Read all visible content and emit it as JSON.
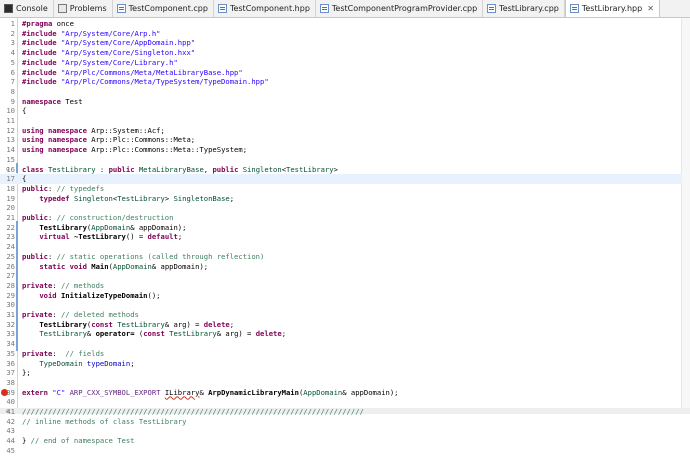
{
  "tabs": [
    {
      "label": "Console",
      "icon": "console-icon"
    },
    {
      "label": "Problems",
      "icon": "problems-icon"
    },
    {
      "label": "TestComponent.cpp",
      "icon": "cpp-file-icon"
    },
    {
      "label": "TestComponent.hpp",
      "icon": "hpp-file-icon"
    },
    {
      "label": "TestComponentProgramProvider.cpp",
      "icon": "cpp-file-icon"
    },
    {
      "label": "TestLibrary.cpp",
      "icon": "cpp-file-icon"
    },
    {
      "label": "TestLibrary.hpp",
      "icon": "hpp-file-icon",
      "active": true,
      "close": "✕"
    }
  ],
  "lines": [
    {
      "n": "1",
      "t": [
        [
          "#pragma",
          "ok"
        ],
        [
          " once",
          ""
        ]
      ]
    },
    {
      "n": "2",
      "t": [
        [
          "#include",
          "ok"
        ],
        [
          " ",
          ""
        ],
        [
          "\"Arp/System/Core/Arp.h\"",
          "st"
        ]
      ]
    },
    {
      "n": "3",
      "t": [
        [
          "#include",
          "ok"
        ],
        [
          " ",
          ""
        ],
        [
          "\"Arp/System/Core/AppDomain.hpp\"",
          "st"
        ]
      ]
    },
    {
      "n": "4",
      "t": [
        [
          "#include",
          "ok"
        ],
        [
          " ",
          ""
        ],
        [
          "\"Arp/System/Core/Singleton.hxx\"",
          "st"
        ]
      ]
    },
    {
      "n": "5",
      "t": [
        [
          "#include",
          "ok"
        ],
        [
          " ",
          ""
        ],
        [
          "\"Arp/System/Core/Library.h\"",
          "st"
        ]
      ]
    },
    {
      "n": "6",
      "t": [
        [
          "#include",
          "ok"
        ],
        [
          " ",
          ""
        ],
        [
          "\"Arp/Plc/Commons/Meta/MetaLibraryBase.hpp\"",
          "st"
        ]
      ]
    },
    {
      "n": "7",
      "t": [
        [
          "#include",
          "ok"
        ],
        [
          " ",
          ""
        ],
        [
          "\"Arp/Plc/Commons/Meta/TypeSystem/TypeDomain.hpp\"",
          "st"
        ]
      ]
    },
    {
      "n": "8",
      "t": []
    },
    {
      "n": "9",
      "t": [
        [
          "namespace",
          "ok"
        ],
        [
          " Test",
          ""
        ]
      ]
    },
    {
      "n": "10",
      "t": [
        [
          "{",
          ""
        ]
      ]
    },
    {
      "n": "11",
      "t": []
    },
    {
      "n": "12",
      "t": [
        [
          "using",
          "ok"
        ],
        [
          " ",
          ""
        ],
        [
          "namespace",
          "ok"
        ],
        [
          " Arp::System::Acf;",
          ""
        ]
      ]
    },
    {
      "n": "13",
      "t": [
        [
          "using",
          "ok"
        ],
        [
          " ",
          ""
        ],
        [
          "namespace",
          "ok"
        ],
        [
          " Arp::Plc::Commons::Meta;",
          ""
        ]
      ]
    },
    {
      "n": "14",
      "t": [
        [
          "using",
          "ok"
        ],
        [
          " ",
          ""
        ],
        [
          "namespace",
          "ok"
        ],
        [
          " Arp::Plc::Commons::Meta::TypeSystem;",
          ""
        ]
      ]
    },
    {
      "n": "15",
      "t": []
    },
    {
      "n": "16",
      "fold": "⊖",
      "t": [
        [
          "class",
          "ok"
        ],
        [
          " ",
          ""
        ],
        [
          "TestLibrary",
          "ty"
        ],
        [
          " : ",
          ""
        ],
        [
          "public",
          "ok"
        ],
        [
          " ",
          ""
        ],
        [
          "MetaLibraryBase",
          "ty"
        ],
        [
          ", ",
          ""
        ],
        [
          "public",
          "ok"
        ],
        [
          " ",
          ""
        ],
        [
          "Singleton",
          "ty"
        ],
        [
          "<",
          ""
        ],
        [
          "TestLibrary",
          "ty"
        ],
        [
          ">",
          ""
        ]
      ]
    },
    {
      "n": "17",
      "current": true,
      "t": [
        [
          "{",
          ""
        ]
      ]
    },
    {
      "n": "18",
      "t": [
        [
          "public",
          "ok"
        ],
        [
          ": ",
          ""
        ],
        [
          "// typedefs",
          "cm"
        ]
      ]
    },
    {
      "n": "19",
      "t": [
        [
          "    ",
          ""
        ],
        [
          "typedef",
          "ok"
        ],
        [
          " ",
          ""
        ],
        [
          "Singleton",
          "ty"
        ],
        [
          "<",
          ""
        ],
        [
          "TestLibrary",
          "ty"
        ],
        [
          "> ",
          ""
        ],
        [
          "SingletonBase",
          "ty"
        ],
        [
          ";",
          ""
        ]
      ]
    },
    {
      "n": "20",
      "t": []
    },
    {
      "n": "21",
      "t": [
        [
          "public",
          "ok"
        ],
        [
          ": ",
          ""
        ],
        [
          "// construction/destruction",
          "cm"
        ]
      ]
    },
    {
      "n": "22",
      "t": [
        [
          "    ",
          ""
        ],
        [
          "TestLibrary",
          "fn"
        ],
        [
          "(",
          ""
        ],
        [
          "AppDomain",
          "ty"
        ],
        [
          "& appDomain);",
          ""
        ]
      ]
    },
    {
      "n": "23",
      "t": [
        [
          "    ",
          ""
        ],
        [
          "virtual",
          "ok"
        ],
        [
          " ",
          ""
        ],
        [
          "~TestLibrary",
          "fn"
        ],
        [
          "() = ",
          ""
        ],
        [
          "default",
          "ok"
        ],
        [
          ";",
          ""
        ]
      ]
    },
    {
      "n": "24",
      "t": []
    },
    {
      "n": "25",
      "t": [
        [
          "public",
          "ok"
        ],
        [
          ": ",
          ""
        ],
        [
          "// static operations (called through reflection)",
          "cm"
        ]
      ]
    },
    {
      "n": "26",
      "t": [
        [
          "    ",
          ""
        ],
        [
          "static",
          "ok"
        ],
        [
          " ",
          ""
        ],
        [
          "void",
          "ok"
        ],
        [
          " ",
          ""
        ],
        [
          "Main",
          "fn"
        ],
        [
          "(",
          ""
        ],
        [
          "AppDomain",
          "ty"
        ],
        [
          "& appDomain);",
          ""
        ]
      ]
    },
    {
      "n": "27",
      "t": []
    },
    {
      "n": "28",
      "t": [
        [
          "private",
          "ok"
        ],
        [
          ": ",
          ""
        ],
        [
          "// methods",
          "cm"
        ]
      ]
    },
    {
      "n": "29",
      "t": [
        [
          "    ",
          ""
        ],
        [
          "void",
          "ok"
        ],
        [
          " ",
          ""
        ],
        [
          "InitializeTypeDomain",
          "fn"
        ],
        [
          "();",
          ""
        ]
      ]
    },
    {
      "n": "30",
      "t": []
    },
    {
      "n": "31",
      "t": [
        [
          "private",
          "ok"
        ],
        [
          ": ",
          ""
        ],
        [
          "// deleted methods",
          "cm"
        ]
      ]
    },
    {
      "n": "32",
      "t": [
        [
          "    ",
          ""
        ],
        [
          "TestLibrary",
          "fn"
        ],
        [
          "(",
          ""
        ],
        [
          "const",
          "ok"
        ],
        [
          " ",
          ""
        ],
        [
          "TestLibrary",
          "ty"
        ],
        [
          "& arg) = ",
          ""
        ],
        [
          "delete",
          "ok"
        ],
        [
          ";",
          ""
        ]
      ]
    },
    {
      "n": "33",
      "t": [
        [
          "    ",
          ""
        ],
        [
          "TestLibrary",
          "ty"
        ],
        [
          "& ",
          ""
        ],
        [
          "operator=",
          "fn"
        ],
        [
          " (",
          ""
        ],
        [
          "const",
          "ok"
        ],
        [
          " ",
          ""
        ],
        [
          "TestLibrary",
          "ty"
        ],
        [
          "& arg) = ",
          ""
        ],
        [
          "delete",
          "ok"
        ],
        [
          ";",
          ""
        ]
      ]
    },
    {
      "n": "34",
      "t": []
    },
    {
      "n": "35",
      "t": [
        [
          "private",
          "ok"
        ],
        [
          ":  ",
          ""
        ],
        [
          "// fields",
          "cm"
        ]
      ]
    },
    {
      "n": "36",
      "t": [
        [
          "    ",
          ""
        ],
        [
          "TypeDomain",
          "ty"
        ],
        [
          " ",
          ""
        ],
        [
          "typeDomain",
          "fl"
        ],
        [
          ";",
          ""
        ]
      ]
    },
    {
      "n": "37",
      "t": [
        [
          "};",
          ""
        ]
      ]
    },
    {
      "n": "38",
      "t": []
    },
    {
      "n": "39",
      "err": true,
      "t": [
        [
          "extern",
          "ok"
        ],
        [
          " ",
          ""
        ],
        [
          "\"C\"",
          "st"
        ],
        [
          " ",
          ""
        ],
        [
          "ARP_CXX_SYMBOL_EXPORT",
          "mc"
        ],
        [
          " ",
          ""
        ],
        [
          "ILibrary",
          "ul"
        ],
        [
          "& ",
          ""
        ],
        [
          "ArpDynamicLibraryMain",
          "fn"
        ],
        [
          "(",
          ""
        ],
        [
          "AppDomain",
          "ty"
        ],
        [
          "& appDomain);",
          ""
        ]
      ]
    },
    {
      "n": "40",
      "t": []
    },
    {
      "n": "41",
      "fold": "⊖",
      "t": [
        [
          "///////////////////////////////////////////////////////////////////////////////",
          "cm"
        ]
      ]
    },
    {
      "n": "42",
      "t": [
        [
          "// inline methods of class TestLibrary",
          "cm"
        ]
      ]
    },
    {
      "n": "43",
      "t": []
    },
    {
      "n": "44",
      "t": [
        [
          "} ",
          ""
        ],
        [
          "// end of namespace Test",
          "cm"
        ]
      ]
    },
    {
      "n": "45",
      "t": []
    }
  ],
  "colors": {
    "keyword": "#7f0055",
    "comment": "#3f7f5f",
    "string": "#2a00ff",
    "type": "#005032",
    "macro": "#642880",
    "field": "#0000c0",
    "current_line": "#e8f2fe",
    "error": "#d3321e"
  }
}
